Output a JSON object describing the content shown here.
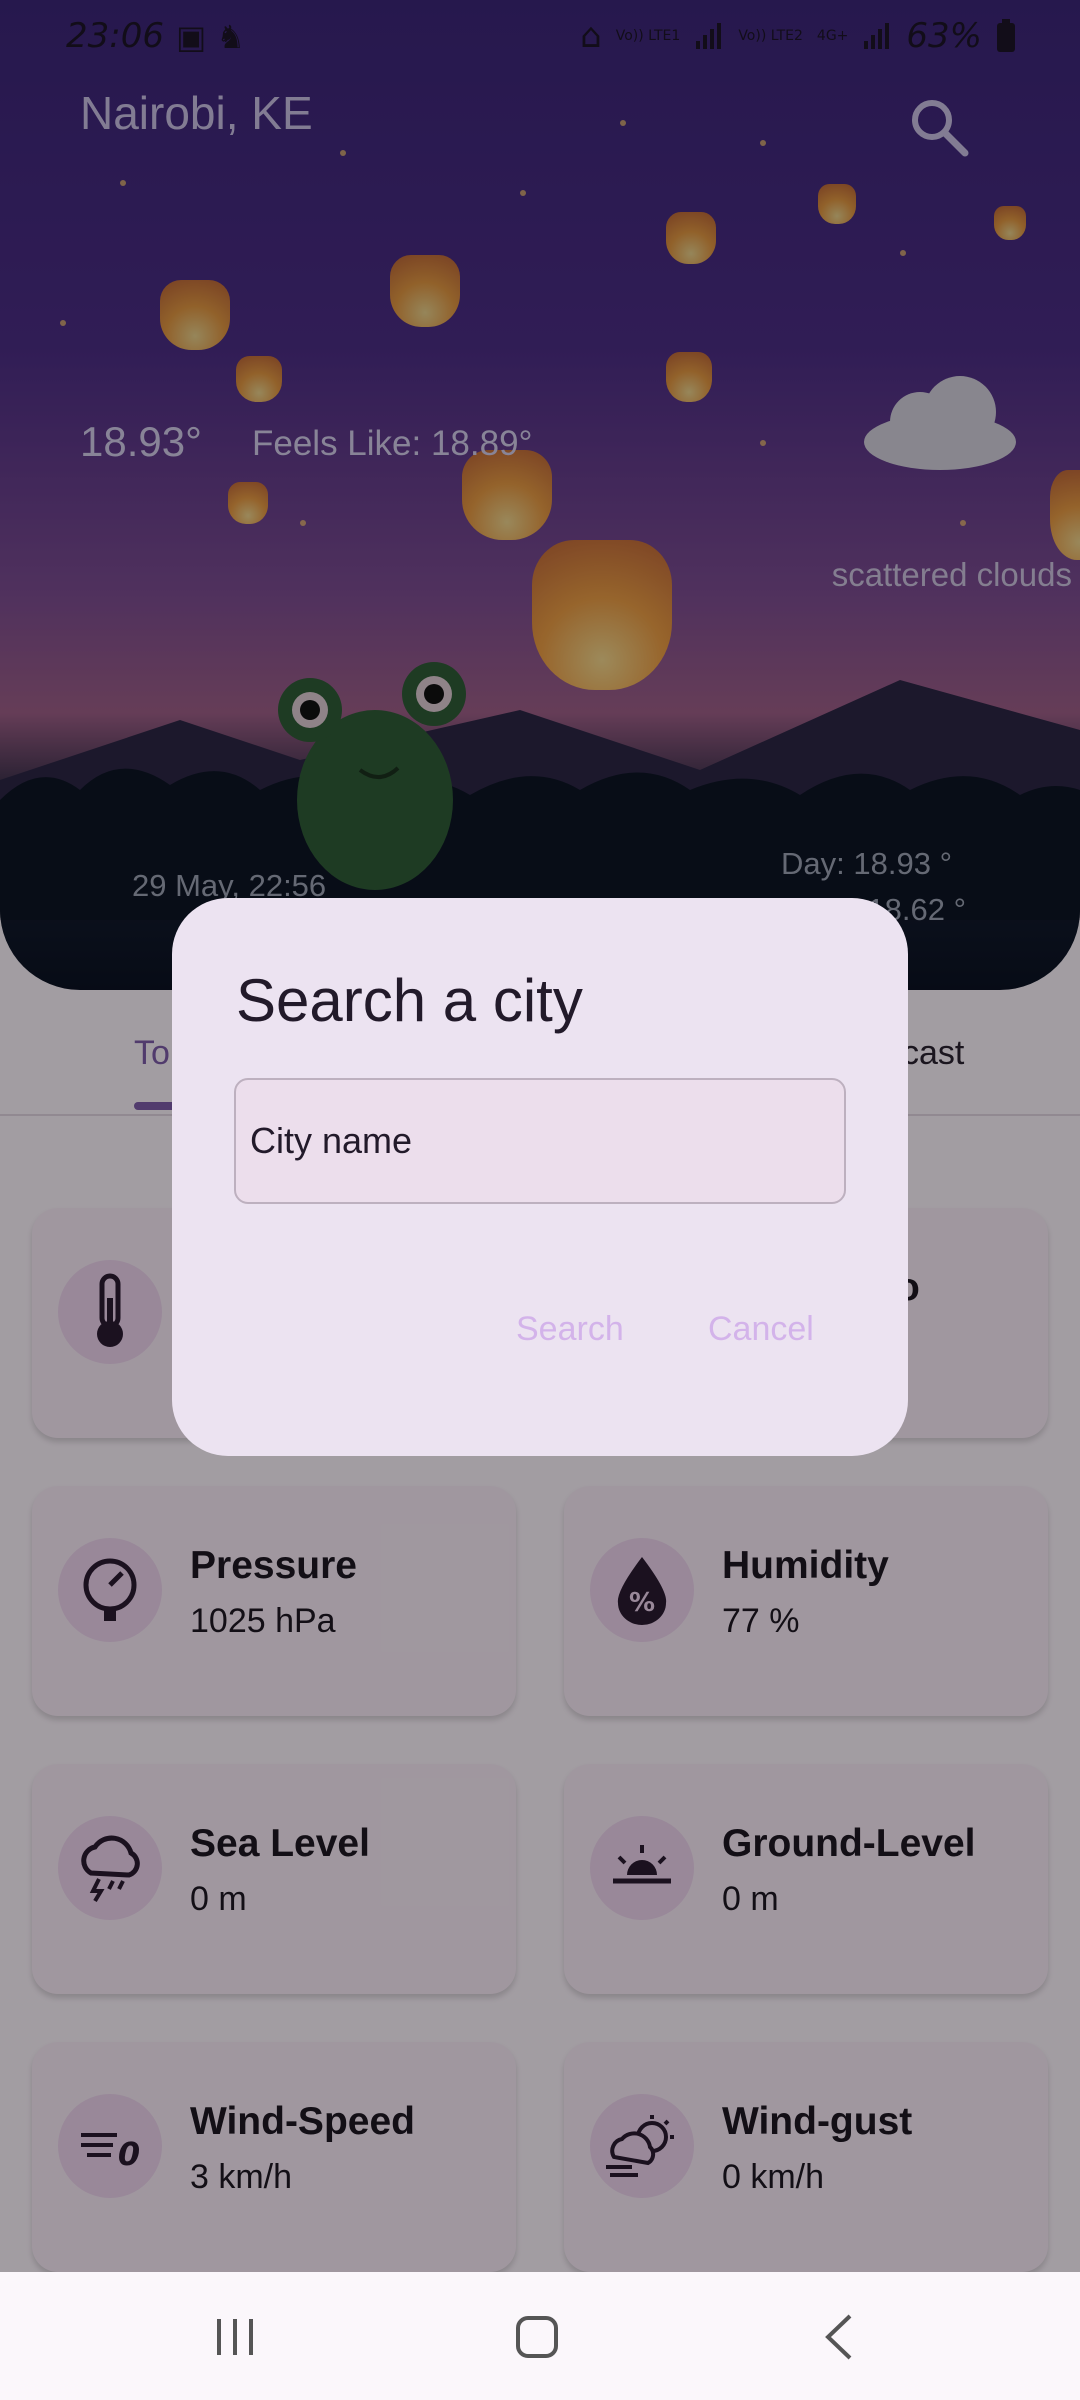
{
  "status": {
    "time": "23:06",
    "net1": "Vo)) LTE1",
    "net2": "Vo)) LTE2",
    "net3": "4G+",
    "battery": "63%"
  },
  "header": {
    "city": "Nairobi, KE"
  },
  "weather": {
    "temp": "18.93°",
    "feels": "Feels Like: 18.89°",
    "description": "scattered clouds",
    "date": "29 May, 22:56",
    "day": "Day: 18.93 °",
    "night": "18.62 °"
  },
  "tabs": [
    {
      "label": "To"
    },
    {
      "label": "cast"
    }
  ],
  "cards": [
    {
      "title": "",
      "value": "",
      "icon": "thermometer-icon"
    },
    {
      "title": "o",
      "value": "",
      "icon": "unknown"
    },
    {
      "title": "Pressure",
      "value": "1025 hPa",
      "icon": "gauge-icon"
    },
    {
      "title": "Humidity",
      "value": "77 %",
      "icon": "humidity-drop-icon"
    },
    {
      "title": "Sea Level",
      "value": "0 m",
      "icon": "storm-cloud-icon"
    },
    {
      "title": "Ground-Level",
      "value": "0 m",
      "icon": "sunrise-icon"
    },
    {
      "title": "Wind-Speed",
      "value": "3 km/h",
      "icon": "wind-icon"
    },
    {
      "title": "Wind-gust",
      "value": "0 km/h",
      "icon": "wind-cloud-sun-icon"
    }
  ],
  "dialog": {
    "title": "Search a city",
    "placeholder": "City name",
    "search_label": "Search",
    "cancel_label": "Cancel"
  },
  "colors": {
    "accent": "#7b5aa6",
    "dialog_bg": "#ece3f1",
    "button_text": "#d3b3ea"
  }
}
